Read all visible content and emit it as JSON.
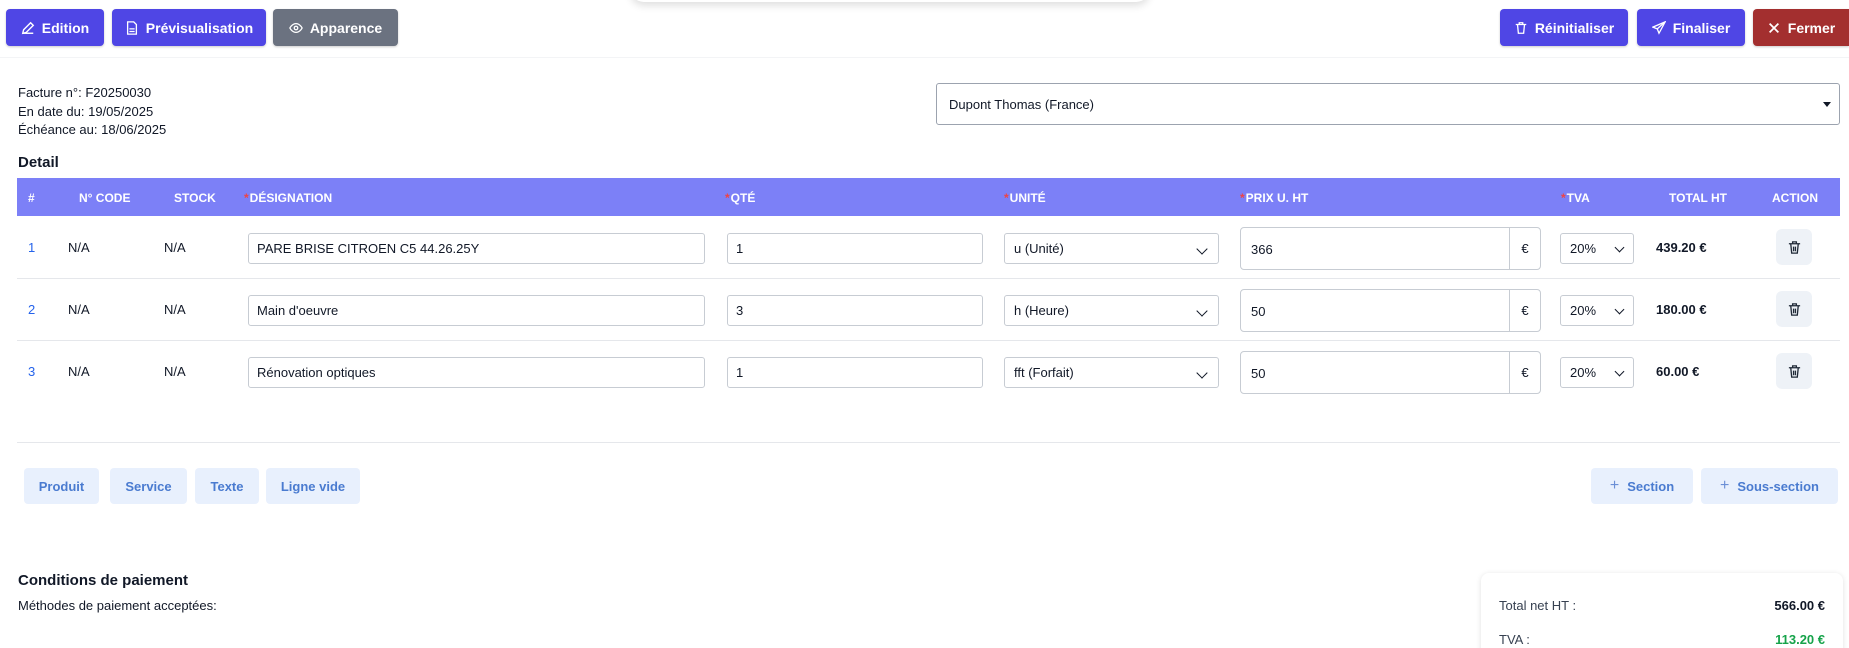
{
  "toolbar": {
    "edition_label": "Edition",
    "preview_label": "Prévisualisation",
    "appearance_label": "Apparence",
    "reset_label": "Réinitialiser",
    "finalize_label": "Finaliser",
    "close_label": "Fermer"
  },
  "invoice": {
    "number_line": "Facture n°: F20250030",
    "date_line": "En date du: 19/05/2025",
    "due_line": "Échéance au: 18/06/2025"
  },
  "client": {
    "selected": "Dupont Thomas (France)"
  },
  "detail": {
    "title": "Detail",
    "headers": {
      "index": "#",
      "code": "N° CODE",
      "stock": "STOCK",
      "designation": "DÉSIGNATION",
      "qty": "QTÉ",
      "unit": "UNITÉ",
      "price": "PRIX U. HT",
      "tva": "TVA",
      "total": "TOTAL HT",
      "action": "ACTION"
    },
    "required_mark": "*",
    "currency": "€",
    "rows": [
      {
        "index": "1",
        "code": "N/A",
        "stock": "N/A",
        "designation": "PARE BRISE CITROEN C5 44.26.25Y",
        "qty": "1",
        "unit": "u (Unité)",
        "price": "366",
        "tva": "20%",
        "total": "439.20 €"
      },
      {
        "index": "2",
        "code": "N/A",
        "stock": "N/A",
        "designation": "Main d'oeuvre",
        "qty": "3",
        "unit": "h (Heure)",
        "price": "50",
        "tva": "20%",
        "total": "180.00 €"
      },
      {
        "index": "3",
        "code": "N/A",
        "stock": "N/A",
        "designation": "Rénovation optiques",
        "qty": "1",
        "unit": "fft (Forfait)",
        "price": "50",
        "tva": "20%",
        "total": "60.00 €"
      }
    ]
  },
  "add_buttons": {
    "product": "Produit",
    "service": "Service",
    "text": "Texte",
    "empty_line": "Ligne vide",
    "section": "Section",
    "subsection": "Sous-section",
    "plus": "+"
  },
  "payment": {
    "title": "Conditions de paiement",
    "methods_label": "Méthodes de paiement acceptées:"
  },
  "totals": {
    "net_label": "Total net HT :",
    "net_value": "566.00 €",
    "tva_label": "TVA :",
    "tva_value": "113.20 €"
  },
  "colors": {
    "primary": "#4f46e5",
    "grey": "#6b7280",
    "danger": "#a32f2f",
    "table_header": "#7c80f7",
    "tva_green": "#16a34a"
  }
}
